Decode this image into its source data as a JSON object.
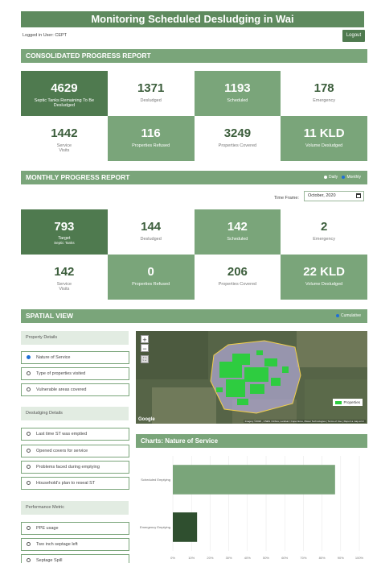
{
  "header": {
    "title": "Monitoring Scheduled Desludging in Wai",
    "logged_in": "Logged in User: CEPT",
    "logout_label": "Logout"
  },
  "consolidated": {
    "title": "CONSOLIDATED PROGRESS REPORT",
    "cells": [
      {
        "value": "4629",
        "label": "Septic Tanks Remaining To Be Desludged"
      },
      {
        "value": "1371",
        "label": "Desludged"
      },
      {
        "value": "1193",
        "label": "Scheduled"
      },
      {
        "value": "178",
        "label": "Emergency"
      },
      {
        "value": "1442",
        "label": "Service Visits"
      },
      {
        "value": "116",
        "label": "Properties Refused"
      },
      {
        "value": "3249",
        "label": "Properties Covered"
      },
      {
        "value": "11 KLD",
        "label": "Volume Desludged"
      }
    ]
  },
  "monthly": {
    "title": "MONTHLY PROGRESS REPORT",
    "toggle_daily": "Daily",
    "toggle_monthly": "Monthly",
    "timeframe_label": "Time Frame:",
    "timeframe_value": "October, 2020",
    "target_value": "793",
    "target_label": "Target",
    "target_sub": "Septic Tanks",
    "cells": [
      {
        "value": "144",
        "label": "Desludged"
      },
      {
        "value": "142",
        "label": "Scheduled"
      },
      {
        "value": "2",
        "label": "Emergency"
      },
      {
        "value": "142",
        "label": "Service Visits"
      },
      {
        "value": "0",
        "label": "Properties Refused"
      },
      {
        "value": "206",
        "label": "Properties Covered"
      },
      {
        "value": "22 KLD",
        "label": "Volume Desludged"
      }
    ]
  },
  "spatial": {
    "title": "SPATIAL VIEW",
    "cumulative": "Cumulative",
    "groups": [
      {
        "title": "Property Details",
        "options": [
          "Nature of Service",
          "Type of properties visited",
          "Vulnerable areas covered"
        ]
      },
      {
        "title": "Desludging Details",
        "options": [
          "Last time ST was emptied",
          "Opened covers for service",
          "Problems faced during emptying",
          "Household's plan to reseal ST"
        ]
      },
      {
        "title": "Performance Metric",
        "options": [
          "PPE usage",
          "Two inch septage left",
          "Septage Spill"
        ]
      }
    ],
    "selected": "Nature of Service",
    "map": {
      "zoom_in": "+",
      "zoom_out": "−",
      "legend": "Properties",
      "google": "Google",
      "attribution": "Imagery ©2020 , CNES / Airbus, Landsat / Copernicus, Maxar Technologies | Terms of Use | Report a map error"
    }
  },
  "charts": {
    "title": "Charts: Nature of Service",
    "chart_data": {
      "type": "bar",
      "orientation": "horizontal",
      "categories": [
        "Scheduled Emptying",
        "Emergency Emptying"
      ],
      "values": [
        87,
        13
      ],
      "xlim": [
        0,
        100
      ],
      "xticks": [
        "0%",
        "10%",
        "20%",
        "30%",
        "40%",
        "50%",
        "60%",
        "70%",
        "80%",
        "90%",
        "100%"
      ],
      "colors": [
        "#7aa57a",
        "#2f4f2f"
      ]
    }
  },
  "colors": {
    "dark": "#4f7a4f",
    "mid": "#7aa57a",
    "header": "#5e8a5e",
    "accent_blue": "#1f6fd6"
  }
}
